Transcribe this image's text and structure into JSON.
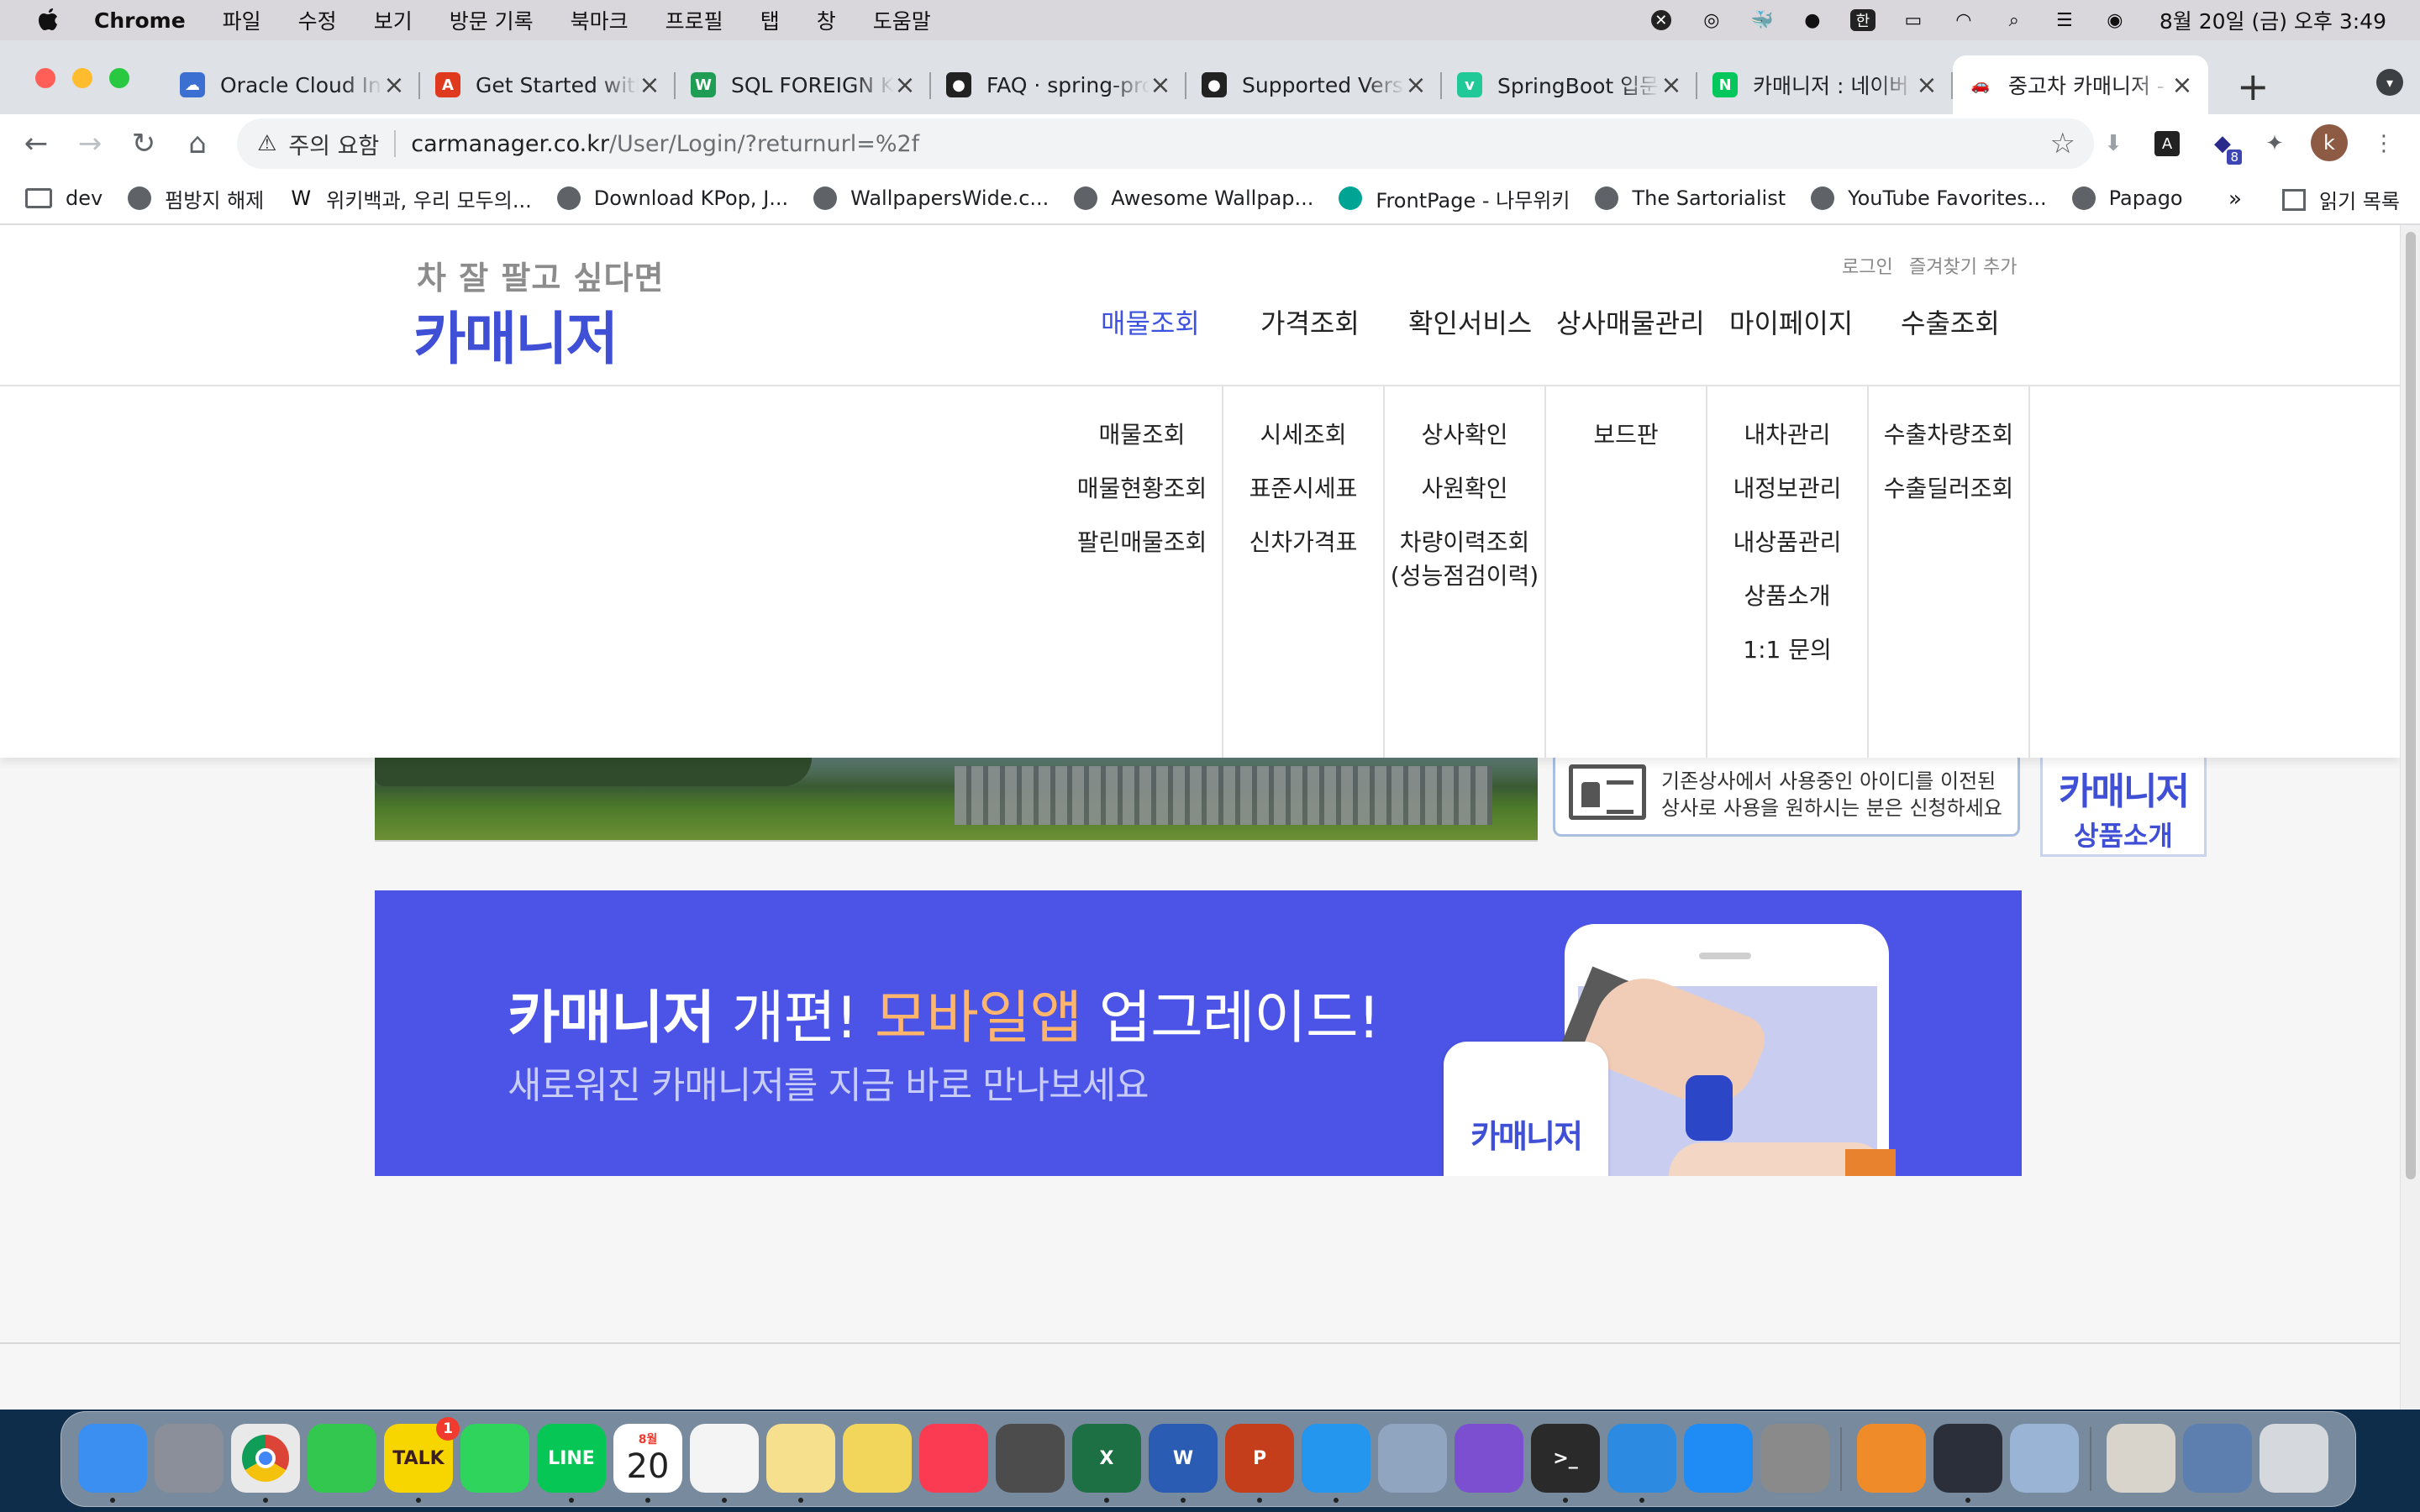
{
  "menubar": {
    "app_name": "Chrome",
    "items": [
      "파일",
      "수정",
      "보기",
      "방문 기록",
      "북마크",
      "프로필",
      "탭",
      "창",
      "도움말"
    ],
    "input_indicator": "한",
    "clock": "8월 20일 (금) 오후 3:49"
  },
  "tabs": [
    {
      "title": "Oracle Cloud Infrastructure",
      "icon": "cloud-icon",
      "color": "#3b6fd1"
    },
    {
      "title": "Get Started with Adobe",
      "icon": "adobe-icon",
      "color": "#e03a1e"
    },
    {
      "title": "SQL FOREIGN KEY",
      "icon": "w3schools-icon",
      "color": "#1f9d55"
    },
    {
      "title": "FAQ · spring-projects",
      "icon": "github-icon",
      "color": "#222222"
    },
    {
      "title": "Supported Versions",
      "icon": "github-icon",
      "color": "#222222"
    },
    {
      "title": "SpringBoot 입문",
      "icon": "velog-icon",
      "color": "#20c997"
    },
    {
      "title": "카매니저 : 네이버",
      "icon": "naver-icon",
      "color": "#03c75a"
    },
    {
      "title": "중고차 카매니저 - ",
      "icon": "car-icon",
      "color": "#ffffff",
      "active": true
    }
  ],
  "toolbar": {
    "security_label": "주의 요함",
    "url_host": "carmanager.co.kr",
    "url_path": "/User/Login/?returnurl=%2f",
    "extension_badge": "8",
    "profile_initial": "k"
  },
  "bookmarks": {
    "items": [
      {
        "label": "dev",
        "type": "folder"
      },
      {
        "label": "펌방지 해제",
        "type": "globe"
      },
      {
        "label": "위키백과, 우리 모두의...",
        "type": "wiki"
      },
      {
        "label": "Download KPop, J...",
        "type": "globe"
      },
      {
        "label": "WallpapersWide.c...",
        "type": "wallpaper"
      },
      {
        "label": "Awesome Wallpap...",
        "type": "globe"
      },
      {
        "label": "FrontPage - 나무위키",
        "type": "namu"
      },
      {
        "label": "The Sartorialist",
        "type": "globe"
      },
      {
        "label": "YouTube Favorites...",
        "type": "globe"
      },
      {
        "label": "Papago",
        "type": "globe"
      }
    ],
    "more": "»",
    "reading_list": "읽기 목록"
  },
  "site": {
    "tagline": "차 잘 팔고 싶다면",
    "logo": "카매니저",
    "util_links": [
      "로그인",
      "즐겨찾기 추가"
    ],
    "gnb": [
      "매물조회",
      "가격조회",
      "확인서비스",
      "상사매물관리",
      "마이페이지",
      "수출조회"
    ],
    "gnb_active": "매물조회",
    "submenus": [
      [
        "매물조회",
        "매물현황조회",
        "팔린매물조회"
      ],
      [
        "시세조회",
        "표준시세표",
        "신차가격표"
      ],
      [
        "상사확인",
        "사원확인",
        "차량이력조회",
        "(성능점검이력)"
      ],
      [
        "보드판"
      ],
      [
        "내차관리",
        "내정보관리",
        "내상품관리",
        "상품소개",
        "1:1 문의"
      ],
      [
        "수출차량조회",
        "수출딜러조회"
      ]
    ],
    "notice": {
      "line1": "기존상사에서 사용중인 아이디를 이전된",
      "line2": "상사로 사용을 원하시는 분은 신청하세요"
    },
    "side_ad": {
      "title": "카매니저",
      "subtitle": "상품소개"
    },
    "promo": {
      "brand": "카매니저",
      "part1": " 개편! ",
      "highlight": "모바일앱",
      "part2": " 업그레이드!",
      "sub": "새로워진 카매니저를 지금 바로 만나보세요",
      "app_label": "카매니저"
    }
  },
  "dock": {
    "calendar_month": "8월",
    "calendar_day": "20",
    "kakaotalk_label": "TALK",
    "kakaotalk_badge": "1",
    "line_label": "LINE",
    "items": [
      "finder-icon",
      "launchpad-icon",
      "chrome-icon",
      "messages-icon",
      "kakaotalk-icon",
      "whatsapp-icon",
      "line-icon",
      "calendar-icon",
      "reminders-icon",
      "notes-icon",
      "stickies-icon",
      "music-icon",
      "screenshot-icon",
      "excel-icon",
      "word-icon",
      "powerpoint-icon",
      "docker-icon",
      "database-icon",
      "github-desktop-icon",
      "terminal-icon",
      "vscode-icon",
      "app-store-icon",
      "system-preferences-icon",
      "reeder-icon",
      "instruments-icon",
      "preview-icon",
      "downloads-folder-icon",
      "screen-folder-icon",
      "trash-icon"
    ]
  }
}
